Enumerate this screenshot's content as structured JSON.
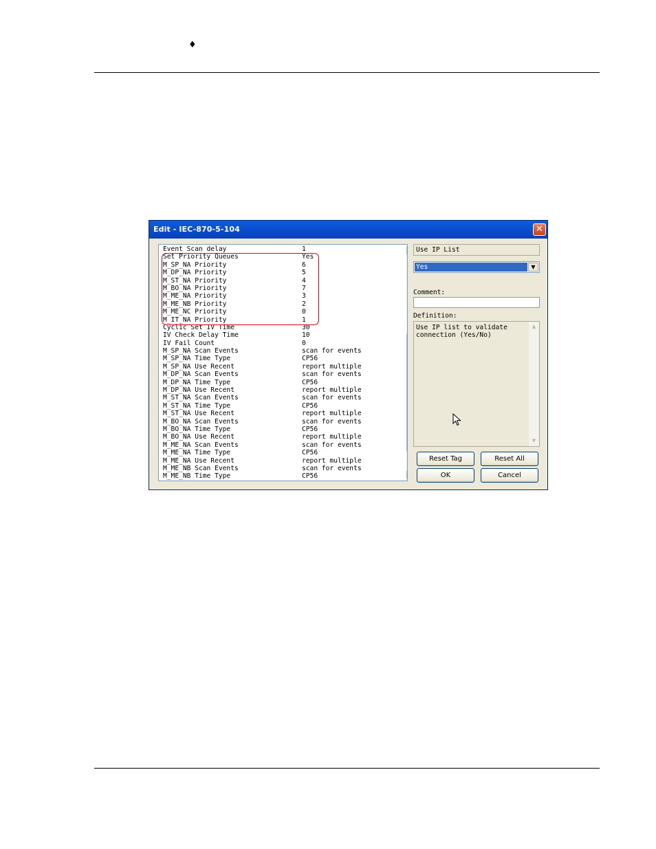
{
  "page": {
    "bullet": "♦"
  },
  "dialog": {
    "title": "Edit - IEC-870-5-104",
    "close_icon": "close-icon",
    "parameters": [
      {
        "name": "Event Scan delay",
        "value": "1"
      },
      {
        "name": "Set Priority Queues",
        "value": "Yes"
      },
      {
        "name": "M_SP_NA Priority",
        "value": "6"
      },
      {
        "name": "M_DP_NA Priority",
        "value": "5"
      },
      {
        "name": "M_ST_NA Priority",
        "value": "4"
      },
      {
        "name": "M_BO_NA Priority",
        "value": "7"
      },
      {
        "name": "M_ME_NA Priority",
        "value": "3"
      },
      {
        "name": "M_ME_NB Priority",
        "value": "2"
      },
      {
        "name": "M_ME_NC Priority",
        "value": "0"
      },
      {
        "name": "M_IT_NA Priority",
        "value": "1"
      },
      {
        "name": "Cyclic Set IV Time",
        "value": "30"
      },
      {
        "name": "IV Check Delay Time",
        "value": "10"
      },
      {
        "name": "IV Fail Count",
        "value": "0"
      },
      {
        "name": "M_SP_NA Scan Events",
        "value": "scan for events"
      },
      {
        "name": "M_SP_NA Time Type",
        "value": "CP56"
      },
      {
        "name": "M_SP_NA Use Recent",
        "value": "report multiple"
      },
      {
        "name": "M_DP_NA Scan Events",
        "value": "scan for events"
      },
      {
        "name": "M_DP_NA Time Type",
        "value": "CP56"
      },
      {
        "name": "M_DP_NA Use Recent",
        "value": "report multiple"
      },
      {
        "name": "M_ST_NA Scan Events",
        "value": "scan for events"
      },
      {
        "name": "M_ST_NA Time Type",
        "value": "CP56"
      },
      {
        "name": "M_ST_NA Use Recent",
        "value": "report multiple"
      },
      {
        "name": "M_BO_NA Scan Events",
        "value": "scan for events"
      },
      {
        "name": "M_BO_NA Time Type",
        "value": "CP56"
      },
      {
        "name": "M_BO_NA Use Recent",
        "value": "report multiple"
      },
      {
        "name": "M_ME_NA Scan Events",
        "value": "scan for events"
      },
      {
        "name": "M_ME_NA Time Type",
        "value": "CP56"
      },
      {
        "name": "M_ME_NA Use Recent",
        "value": "report multiple"
      },
      {
        "name": "M_ME_NB Scan Events",
        "value": "scan for events"
      },
      {
        "name": "M_ME_NB Time Type",
        "value": "CP56"
      }
    ],
    "selected_parameter": "Use IP List",
    "value_select": "Yes",
    "comment_label": "Comment:",
    "comment_value": "",
    "definition_label": "Definition:",
    "definition_text": "Use IP list to validate connection (Yes/No)",
    "buttons": {
      "reset_tag": "Reset Tag",
      "reset_all": "Reset All",
      "ok": "OK",
      "cancel": "Cancel"
    },
    "highlight_color": "#e0001a",
    "titlebar_color": "#0a4fd0"
  }
}
